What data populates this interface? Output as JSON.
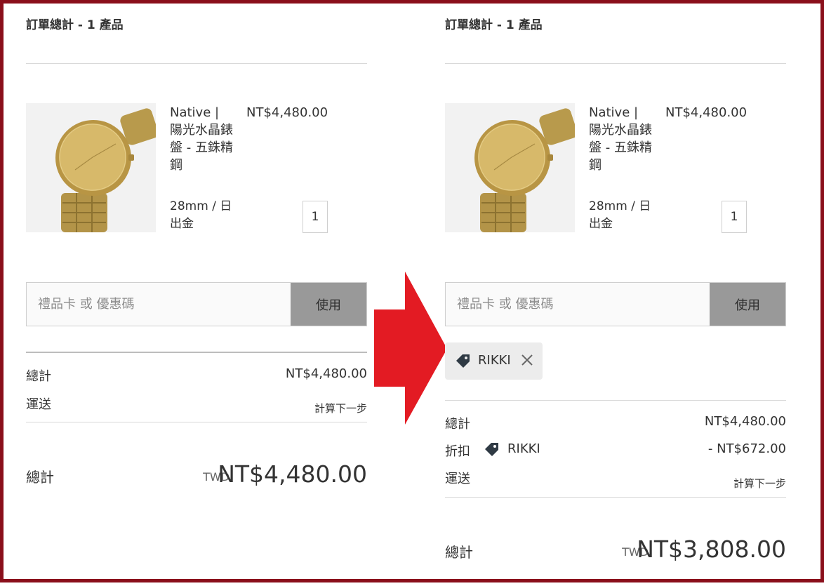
{
  "colors": {
    "frame": "#8a0f1b",
    "arrow": "#e31b23",
    "apply_button": "#999999",
    "chip_bg": "#ececec"
  },
  "before": {
    "title": "訂單總計 - 1 產品",
    "product": {
      "name": "Native | 陽光水晶錶盤 - 五銖精鋼",
      "variant": "28mm / 日出金",
      "price": "NT$4,480.00",
      "quantity": "1"
    },
    "coupon": {
      "placeholder": "禮品卡 或 優惠碼",
      "apply_label": "使用"
    },
    "summary": {
      "subtotal_label": "總計",
      "subtotal_value": "NT$4,480.00",
      "shipping_label": "運送",
      "shipping_value": "計算下一步"
    },
    "total": {
      "label": "總計",
      "currency": "TWD",
      "amount": "NT$4,480.00"
    }
  },
  "after": {
    "title": "訂單總計 - 1 產品",
    "product": {
      "name": "Native | 陽光水晶錶盤 - 五銖精鋼",
      "variant": "28mm / 日出金",
      "price": "NT$4,480.00",
      "quantity": "1"
    },
    "coupon": {
      "placeholder": "禮品卡 或 優惠碼",
      "apply_label": "使用"
    },
    "applied_code": {
      "code": "RIKKI",
      "icon": "tag-icon",
      "remove_icon": "close-icon"
    },
    "summary": {
      "subtotal_label": "總計",
      "subtotal_value": "NT$4,480.00",
      "discount_label": "折扣",
      "discount_code": "RIKKI",
      "discount_value": "- NT$672.00",
      "shipping_label": "運送",
      "shipping_value": "計算下一步"
    },
    "total": {
      "label": "總計",
      "currency": "TWD",
      "amount": "NT$3,808.00"
    }
  }
}
